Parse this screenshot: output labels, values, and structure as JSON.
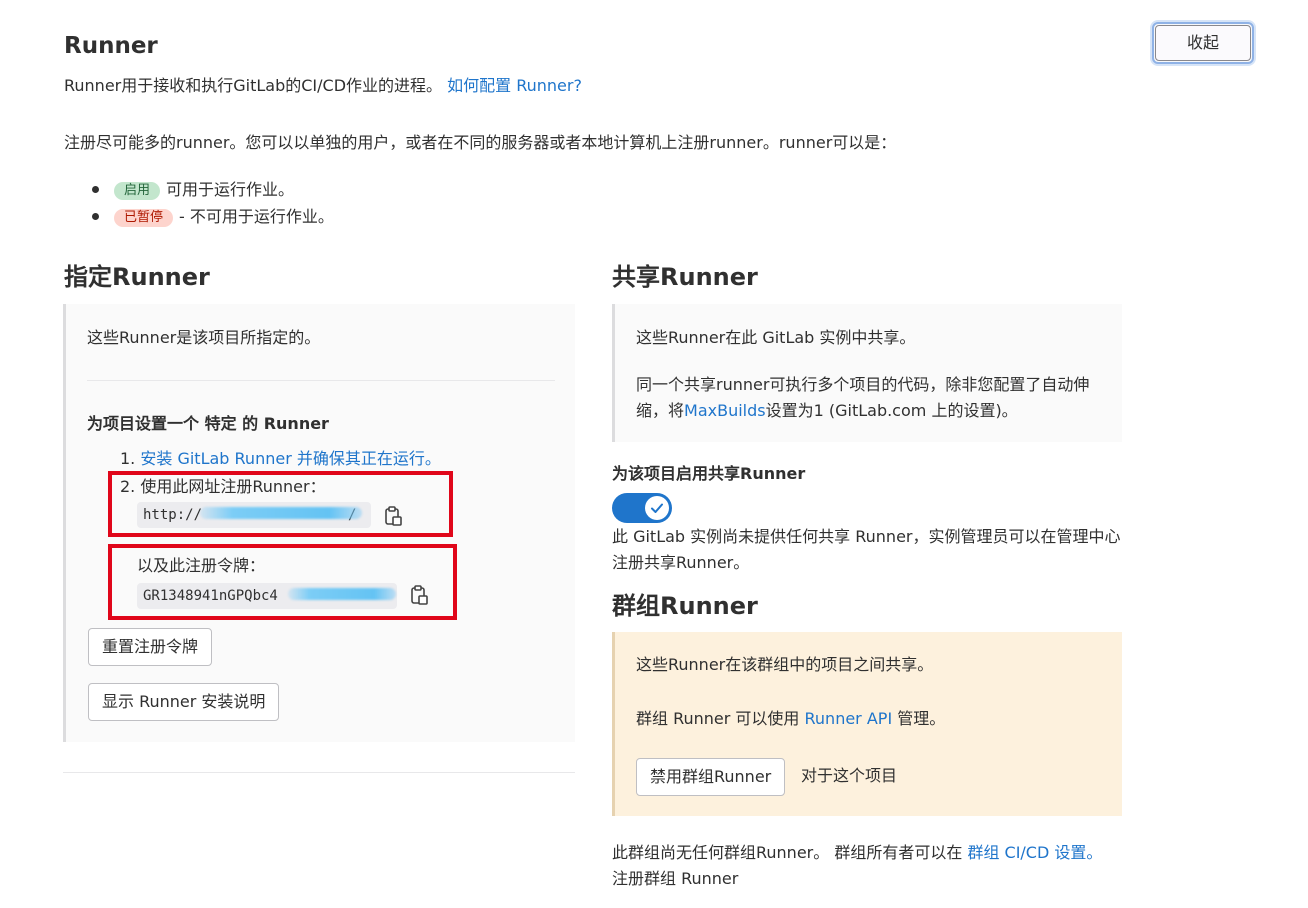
{
  "header": {
    "title": "Runner",
    "collapse_label": "收起",
    "intro_text": "Runner用于接收和执行GitLab的CI/CD作业的进程。",
    "intro_link": "如何配置 Runner?",
    "register_text": "注册尽可能多的runner。您可以以单独的用户，或者在不同的服务器或者本地计算机上注册runner。runner可以是：",
    "statuses": [
      {
        "badge": "启用",
        "text": "可用于运行作业。"
      },
      {
        "badge": "已暂停",
        "text": "- 不可用于运行作业。"
      }
    ]
  },
  "specific": {
    "title": "指定Runner",
    "description": "这些Runner是该项目所指定的。",
    "setup_heading": "为项目设置一个 特定 的 Runner",
    "step1_num": "1.",
    "step1_link": "安装 GitLab Runner 并确保其正在运行。",
    "step2_text": "2. 使用此网址注册Runner：",
    "url_value": "http://",
    "url_suffix": "/",
    "token_label": "以及此注册令牌：",
    "token_value": "GR1348941nGPQbc4",
    "reset_label": "重置注册令牌",
    "show_label": "显示 Runner 安装说明"
  },
  "shared": {
    "title": "共享Runner",
    "p1": "这些Runner在此 GitLab 实例中共享。",
    "p2_prefix": "同一个共享runner可执行多个项目的代码，除非您配置了自动伸缩，将",
    "p2_link": "MaxBuilds",
    "p2_suffix": "设置为1 (GitLab.com 上的设置)。",
    "enable_label": "为该项目启用共享Runner",
    "toggle_on": true,
    "note": "此 GitLab 实例尚未提供任何共享 Runner，实例管理员可以在管理中心注册共享Runner。"
  },
  "group": {
    "title": "群组Runner",
    "p1": "这些Runner在该群组中的项目之间共享。",
    "p2_prefix": "群组 Runner 可以使用",
    "p2_link": "Runner API",
    "p2_suffix": "管理。",
    "disable_label": "禁用群组Runner",
    "disable_suffix": "对于这个项目",
    "note_prefix": "此群组尚无任何群组Runner。 群组所有者可以在",
    "note_link": "群组 CI/CD 设置。",
    "note_suffix": "注册群组 Runner"
  },
  "colors": {
    "link": "#1f75cb",
    "toggle": "#1f75cb",
    "highlight_box": "#e0061a",
    "group_bg": "#fdf1dd"
  }
}
